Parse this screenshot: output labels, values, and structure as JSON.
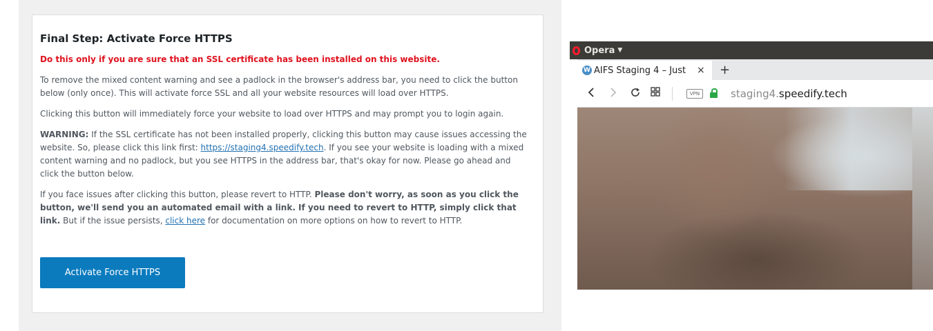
{
  "notice": {
    "title": "Final Step: Activate Force HTTPS",
    "alert": "Do this only if you are sure that an SSL certificate has been installed on this website.",
    "p1": "To remove the mixed content warning and see a padlock in the browser's address bar, you need to click the button below (only once). This will activate force SSL and all your website resources will load over HTTPS.",
    "p2": "Clicking this button will immediately force your website to load over HTTPS and may prompt you to login again.",
    "warning_label": "WARNING:",
    "warning_text_1": " If the SSL certificate has not been installed properly, clicking this button may cause issues accessing the website. So, please click this link first: ",
    "warning_link": "https://staging4.speedify.tech",
    "warning_text_2": ". If you see your website is loading with a mixed content warning and no padlock, but you see HTTPS in the address bar, that's okay for now. Please go ahead and click the button below.",
    "p4_text_1": "If you face issues after clicking this button, please revert to HTTP. ",
    "p4_bold": "Please don't worry, as soon as you click the button, we'll send you an automated email with a link. If you need to revert to HTTP, simply click that link.",
    "p4_text_2": " But if the issue persists, ",
    "p4_link": "click here",
    "p4_text_3": " for documentation on more options on how to revert to HTTP.",
    "button_label": "Activate Force HTTPS"
  },
  "browser": {
    "app_name": "Opera",
    "tab_title": "AIFS Staging 4 – Just",
    "tab_close": "×",
    "new_tab": "+",
    "vpn_label": "VPN",
    "url_subdomain": "staging4.",
    "url_domain": "speedify.tech",
    "icons": {
      "back": "chevron-left-icon",
      "forward": "chevron-right-icon",
      "reload": "reload-icon",
      "speed_dial": "grid-icon",
      "lock": "lock-icon"
    }
  },
  "colors": {
    "button": "#0b7bbe",
    "alert": "#e0121e",
    "link": "#2271b1",
    "lock": "#2aa745"
  }
}
